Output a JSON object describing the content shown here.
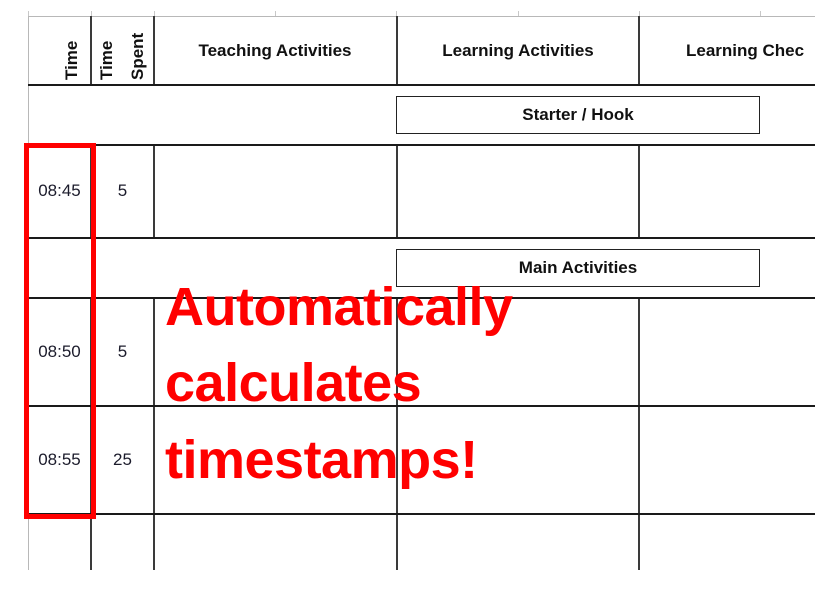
{
  "header": {
    "time": "Time",
    "time_spent_line1": "Time",
    "time_spent_line2": "Spent",
    "teaching_activities": "Teaching Activities",
    "learning_activities": "Learning Activities",
    "learning_checks": "Learning Chec"
  },
  "sections": {
    "starter": "Starter / Hook",
    "main": "Main Activities"
  },
  "rows": [
    {
      "time": "08:45",
      "time_spent": "5"
    },
    {
      "time": "08:50",
      "time_spent": "5"
    },
    {
      "time": "08:55",
      "time_spent": "25"
    }
  ],
  "annotation": {
    "line1": "Automatically",
    "line2": "calculates",
    "line3": "timestamps!",
    "color": "#ff0000"
  }
}
